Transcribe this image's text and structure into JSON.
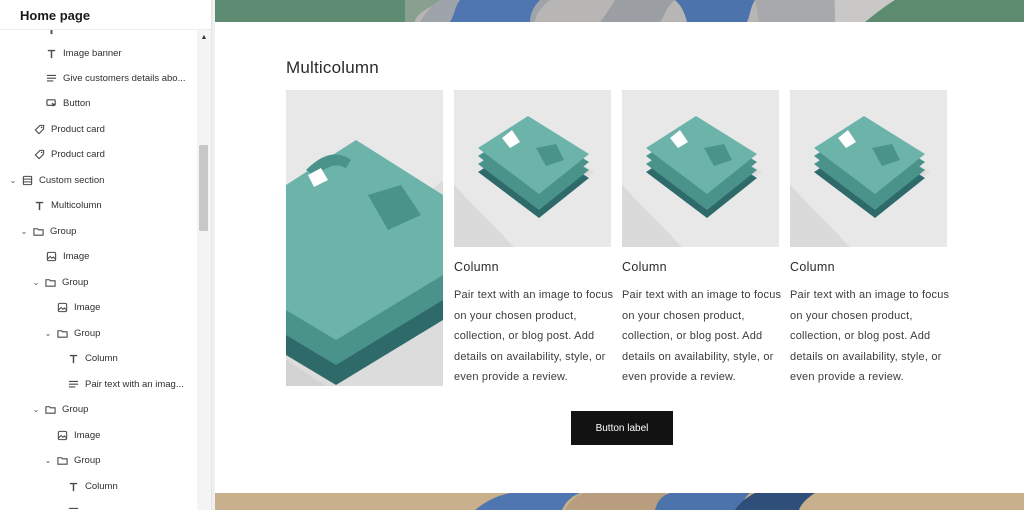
{
  "sidebar": {
    "title": "Home page",
    "items": [
      {
        "label": "Image banner",
        "icon": "text-icon"
      },
      {
        "label": "Give customers details abo...",
        "icon": "paragraph-icon"
      },
      {
        "label": "Button",
        "icon": "button-cursor-icon"
      },
      {
        "label": "Product card",
        "icon": "tag-icon"
      },
      {
        "label": "Product card",
        "icon": "tag-icon"
      },
      {
        "label": "Custom section",
        "icon": "section-icon"
      },
      {
        "label": "Multicolumn",
        "icon": "text-icon"
      },
      {
        "label": "Group",
        "icon": "folder-icon"
      },
      {
        "label": "Image",
        "icon": "image-icon"
      },
      {
        "label": "Group",
        "icon": "folder-icon"
      },
      {
        "label": "Image",
        "icon": "image-icon"
      },
      {
        "label": "Group",
        "icon": "folder-icon"
      },
      {
        "label": "Column",
        "icon": "text-icon"
      },
      {
        "label": "Pair text with an imag...",
        "icon": "paragraph-icon"
      },
      {
        "label": "Group",
        "icon": "folder-icon"
      },
      {
        "label": "Image",
        "icon": "image-icon"
      },
      {
        "label": "Group",
        "icon": "folder-icon"
      },
      {
        "label": "Column",
        "icon": "text-icon"
      }
    ]
  },
  "preview": {
    "section_title": "Multicolumn",
    "columns": [
      {
        "heading": "Column",
        "text": "Pair text with an image to focus on your chosen product, collection, or blog post. Add details on availability, style, or even provide a review."
      },
      {
        "heading": "Column",
        "text": "Pair text with an image to focus on your chosen product, collection, or blog post. Add details on availability, style, or even provide a review."
      },
      {
        "heading": "Column",
        "text": "Pair text with an image to focus on your chosen product, collection, or blog post. Add details on availability, style, or even provide a review."
      }
    ],
    "button_label": "Button label"
  },
  "colors": {
    "shirt_light": "#6cb3aa",
    "shirt_mid": "#4a938b",
    "shirt_dark": "#2f6a6a",
    "image_bg": "#e8e8e8",
    "button_bg": "#121212"
  }
}
